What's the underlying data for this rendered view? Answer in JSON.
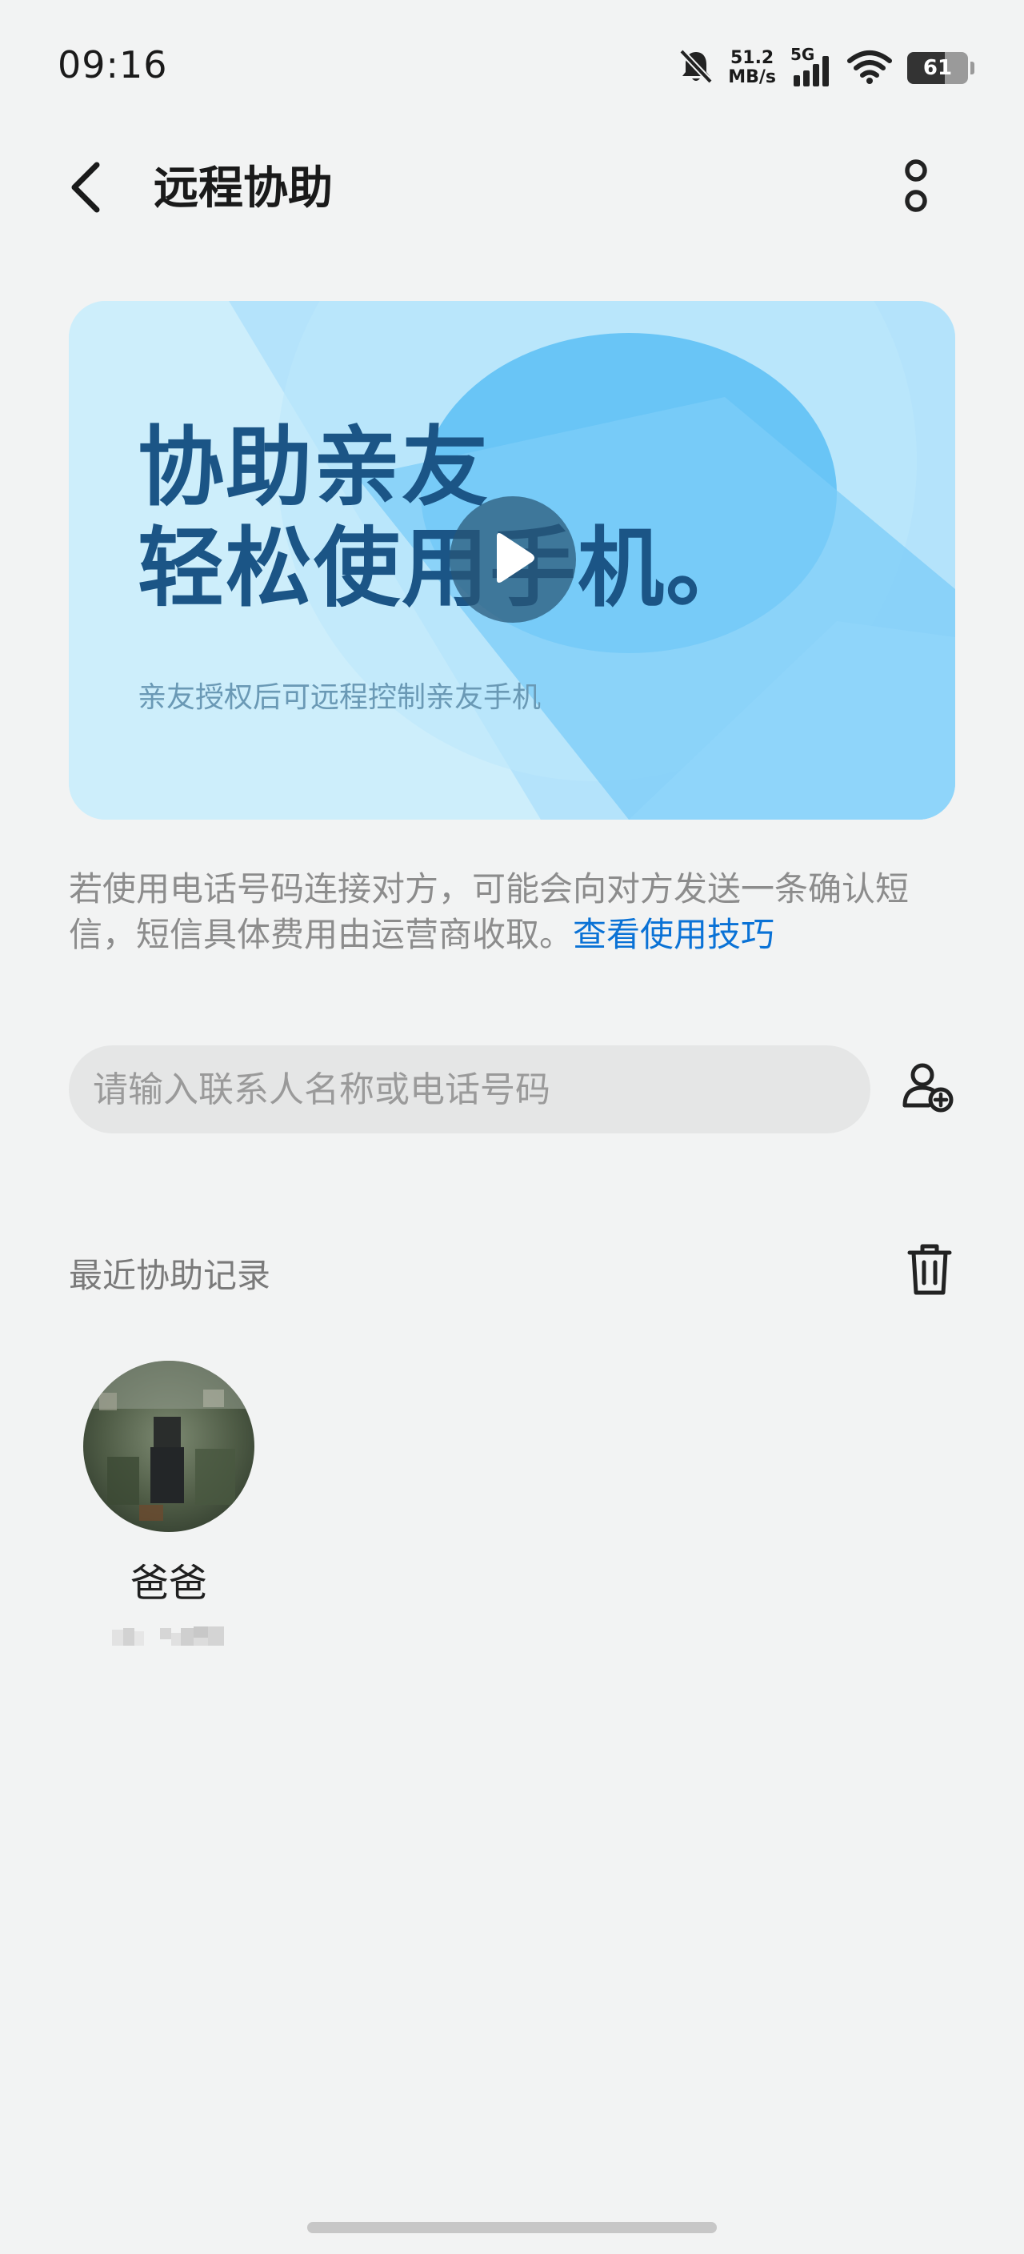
{
  "status_bar": {
    "time": "09:16",
    "net_speed_value": "51.2",
    "net_speed_unit": "MB/s",
    "network_type": "5G",
    "battery_level": "61",
    "icons": [
      "bell-muted-icon",
      "signal-icon",
      "wifi-icon",
      "battery-icon"
    ]
  },
  "header": {
    "title": "远程协助",
    "icons": [
      "back-arrow-icon",
      "more-vertical-icon"
    ]
  },
  "banner": {
    "headline_line1": "协助亲友",
    "headline_line2": "轻松使用手机。",
    "subtitle": "亲友授权后可远程控制亲友手机",
    "icon": "play-icon"
  },
  "notice": {
    "text": "若使用电话号码连接对方，可能会向对方发送一条确认短信，短信具体费用由运营商收取。",
    "link_label": "查看使用技巧"
  },
  "search": {
    "placeholder": "请输入联系人名称或电话号码",
    "value": "",
    "add_icon": "add-contact-icon"
  },
  "recent": {
    "section_title": "最近协助记录",
    "delete_icon": "trash-icon",
    "contacts": [
      {
        "name": "爸爸"
      }
    ]
  },
  "colors": {
    "background": "#f2f3f3",
    "headline": "#1b5586",
    "link": "#0a72d6",
    "banner_light": "#cdeefb",
    "banner_blue": "#63c3f8"
  }
}
